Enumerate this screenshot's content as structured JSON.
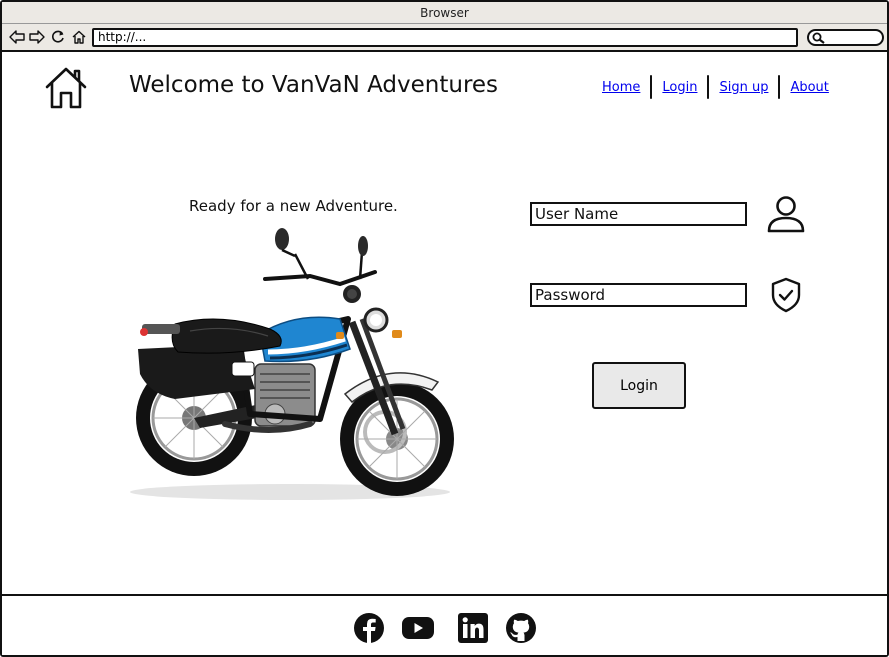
{
  "browser": {
    "title": "Browser",
    "address": "http://..."
  },
  "header": {
    "title": "Welcome to VanVaN Adventures",
    "nav": [
      {
        "label": "Home"
      },
      {
        "label": "Login"
      },
      {
        "label": "Sign up"
      },
      {
        "label": "About"
      }
    ]
  },
  "main": {
    "tagline": "Ready for a new Adventure.",
    "image": "motorcycle",
    "form": {
      "username_placeholder": "User Name",
      "password_placeholder": "Password",
      "login_label": "Login"
    }
  },
  "footer": {
    "social": [
      "facebook-icon",
      "youtube-icon",
      "linkedin-icon",
      "github-icon"
    ]
  },
  "colors": {
    "link": "#0000ee",
    "chrome": "#ece9e4",
    "button": "#e9e9e9"
  }
}
